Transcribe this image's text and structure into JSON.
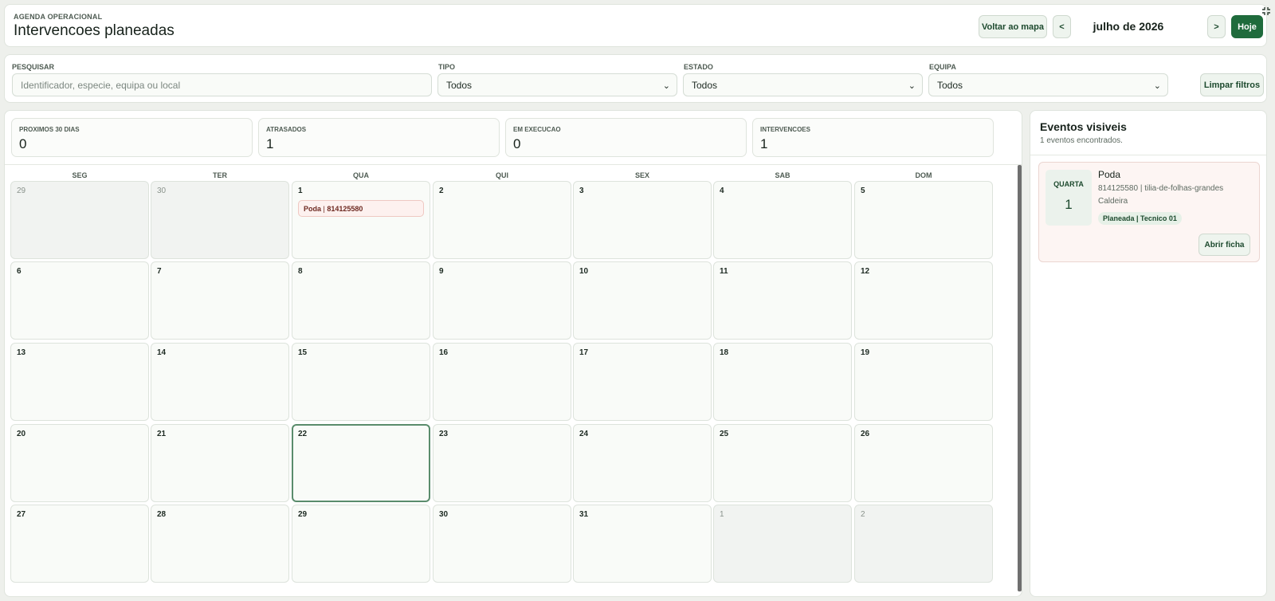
{
  "header": {
    "eyebrow": "AGENDA OPERACIONAL",
    "title": "Intervencoes planeadas",
    "back_to_map": "Voltar ao mapa",
    "prev": "<",
    "month": "julho de 2026",
    "next": ">",
    "today": "Hoje"
  },
  "filters": {
    "search": {
      "label": "PESQUISAR",
      "placeholder": "Identificador, especie, equipa ou local",
      "value": ""
    },
    "tipo": {
      "label": "TIPO",
      "value": "Todos"
    },
    "estado": {
      "label": "ESTADO",
      "value": "Todos"
    },
    "equipa": {
      "label": "EQUIPA",
      "value": "Todos"
    },
    "clear": "Limpar filtros"
  },
  "stats": [
    {
      "label": "PROXIMOS 30 DIAS",
      "value": "0"
    },
    {
      "label": "ATRASADOS",
      "value": "1"
    },
    {
      "label": "EM EXECUCAO",
      "value": "0"
    },
    {
      "label": "INTERVENCOES",
      "value": "1"
    }
  ],
  "calendar": {
    "weekdays": [
      "SEG",
      "TER",
      "QUA",
      "QUI",
      "SEX",
      "SAB",
      "DOM"
    ],
    "weeks": [
      [
        {
          "day": "29",
          "outside": true
        },
        {
          "day": "30",
          "outside": true
        },
        {
          "day": "1",
          "event_type": "Poda",
          "event_id": "814125580"
        },
        {
          "day": "2"
        },
        {
          "day": "3"
        },
        {
          "day": "4"
        },
        {
          "day": "5"
        }
      ],
      [
        {
          "day": "6"
        },
        {
          "day": "7"
        },
        {
          "day": "8"
        },
        {
          "day": "9"
        },
        {
          "day": "10"
        },
        {
          "day": "11"
        },
        {
          "day": "12"
        }
      ],
      [
        {
          "day": "13"
        },
        {
          "day": "14"
        },
        {
          "day": "15"
        },
        {
          "day": "16"
        },
        {
          "day": "17"
        },
        {
          "day": "18"
        },
        {
          "day": "19"
        }
      ],
      [
        {
          "day": "20"
        },
        {
          "day": "21"
        },
        {
          "day": "22",
          "today": true
        },
        {
          "day": "23"
        },
        {
          "day": "24"
        },
        {
          "day": "25"
        },
        {
          "day": "26"
        }
      ],
      [
        {
          "day": "27"
        },
        {
          "day": "28"
        },
        {
          "day": "29"
        },
        {
          "day": "30"
        },
        {
          "day": "31"
        },
        {
          "day": "1",
          "outside": true
        },
        {
          "day": "2",
          "outside": true
        }
      ]
    ]
  },
  "side": {
    "title": "Eventos visiveis",
    "count": "1 eventos encontrados.",
    "event": {
      "weekday": "QUARTA",
      "day": "1",
      "title": "Poda",
      "meta": "814125580 | tilia-de-folhas-grandes",
      "location": "Caldeira",
      "badge": "Planeada | Tecnico 01",
      "open": "Abrir ficha"
    }
  },
  "colors": {
    "accent": "#1f6b3c",
    "event_bg": "#fdf1ef",
    "event_text": "#6e2a22",
    "today_border": "#5a8c6c"
  }
}
